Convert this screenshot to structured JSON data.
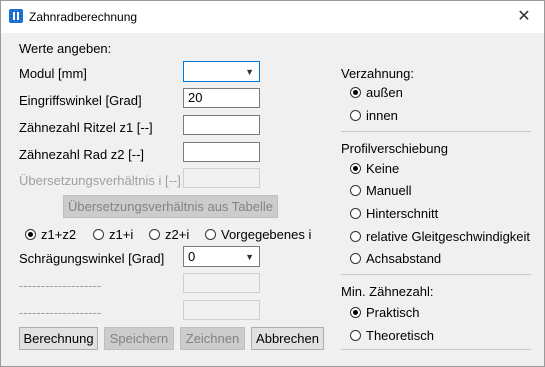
{
  "window": {
    "title": "Zahnradberechnung",
    "close_glyph": "✕"
  },
  "left": {
    "heading": "Werte angeben:",
    "modul_label": "Modul [mm]",
    "modul_value": "",
    "eingriff_label": "Eingriffswinkel [Grad]",
    "eingriff_value": "20",
    "z1_label": "Zähnezahl Ritzel z1 [--]",
    "z1_value": "",
    "z2_label": "Zähnezahl Rad z2 [--]",
    "z2_value": "",
    "ratio_label": "Übersetzungsverhältnis i [--]",
    "ratio_value": "",
    "table_button": "Übersetzungsverhältnis aus Tabelle",
    "mode_options": [
      "z1+z2",
      "z1+i",
      "z2+i",
      "Vorgegebenes i"
    ],
    "mode_selected": 0,
    "helix_label": "Schrägungswinkel [Grad]",
    "helix_value": "0",
    "placeholder1": "-------------------",
    "placeholder2": "-------------------",
    "buttons": {
      "calc": "Berechnung",
      "save": "Speichern",
      "draw": "Zeichnen",
      "cancel": "Abbrechen"
    }
  },
  "right": {
    "verzahnung_title": "Verzahnung:",
    "verzahnung_options": [
      "außen",
      "innen"
    ],
    "verzahnung_selected": 0,
    "profil_title": "Profilverschiebung",
    "profil_options": [
      "Keine",
      "Manuell",
      "Hinterschnitt",
      "relative Gleitgeschwindigkeit",
      "Achsabstand"
    ],
    "profil_selected": 0,
    "min_title": "Min. Zähnezahl:",
    "min_options": [
      "Praktisch",
      "Theoretisch"
    ],
    "min_selected": 0
  },
  "icons": {
    "close": "close-icon",
    "app": "gear-app-icon",
    "dropdown": "chevron-down-icon"
  }
}
